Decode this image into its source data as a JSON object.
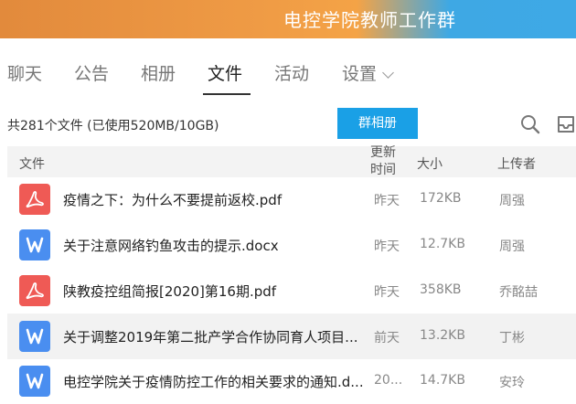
{
  "window": {
    "title": "电控学院教师工作群"
  },
  "tabs": [
    {
      "label": "聊天",
      "active": false
    },
    {
      "label": "公告",
      "active": false
    },
    {
      "label": "相册",
      "active": false
    },
    {
      "label": "文件",
      "active": true
    },
    {
      "label": "活动",
      "active": false
    },
    {
      "label": "设置",
      "active": false,
      "dropdown": true
    }
  ],
  "toolbar": {
    "summary": "共281个文件 (已使用520MB/10GB)",
    "album_button": "群相册",
    "search_icon": "search-icon",
    "inbox_icon": "inbox-icon",
    "accent_color": "#1aa0e6"
  },
  "table": {
    "headers": {
      "name": "文件",
      "updated_line1": "更新",
      "updated_line2": "时间",
      "size": "大小",
      "uploader": "上传者"
    },
    "rows": [
      {
        "type": "pdf",
        "icon": "pdf-icon",
        "name": "疫情之下：为什么不要提前返校.pdf",
        "time": "昨天",
        "size": "172KB",
        "uploader": "周强"
      },
      {
        "type": "doc",
        "icon": "word-icon",
        "name": "关于注意网络钓鱼攻击的提示.docx",
        "time": "昨天",
        "size": "12.7KB",
        "uploader": "周强"
      },
      {
        "type": "pdf",
        "icon": "pdf-icon",
        "name": "陕教疫控组简报[2020]第16期.pdf",
        "time": "昨天",
        "size": "358KB",
        "uploader": "乔酩喆"
      },
      {
        "type": "doc",
        "icon": "word-icon",
        "name": "关于调整2019年第二批产学合作协同育人项目...",
        "time": "前天",
        "size": "13.2KB",
        "uploader": "丁彬"
      },
      {
        "type": "doc",
        "icon": "word-icon",
        "name": "电控学院关于疫情防控工作的相关要求的通知.d...",
        "time": "20...",
        "size": "14.7KB",
        "uploader": "安玲"
      }
    ]
  }
}
